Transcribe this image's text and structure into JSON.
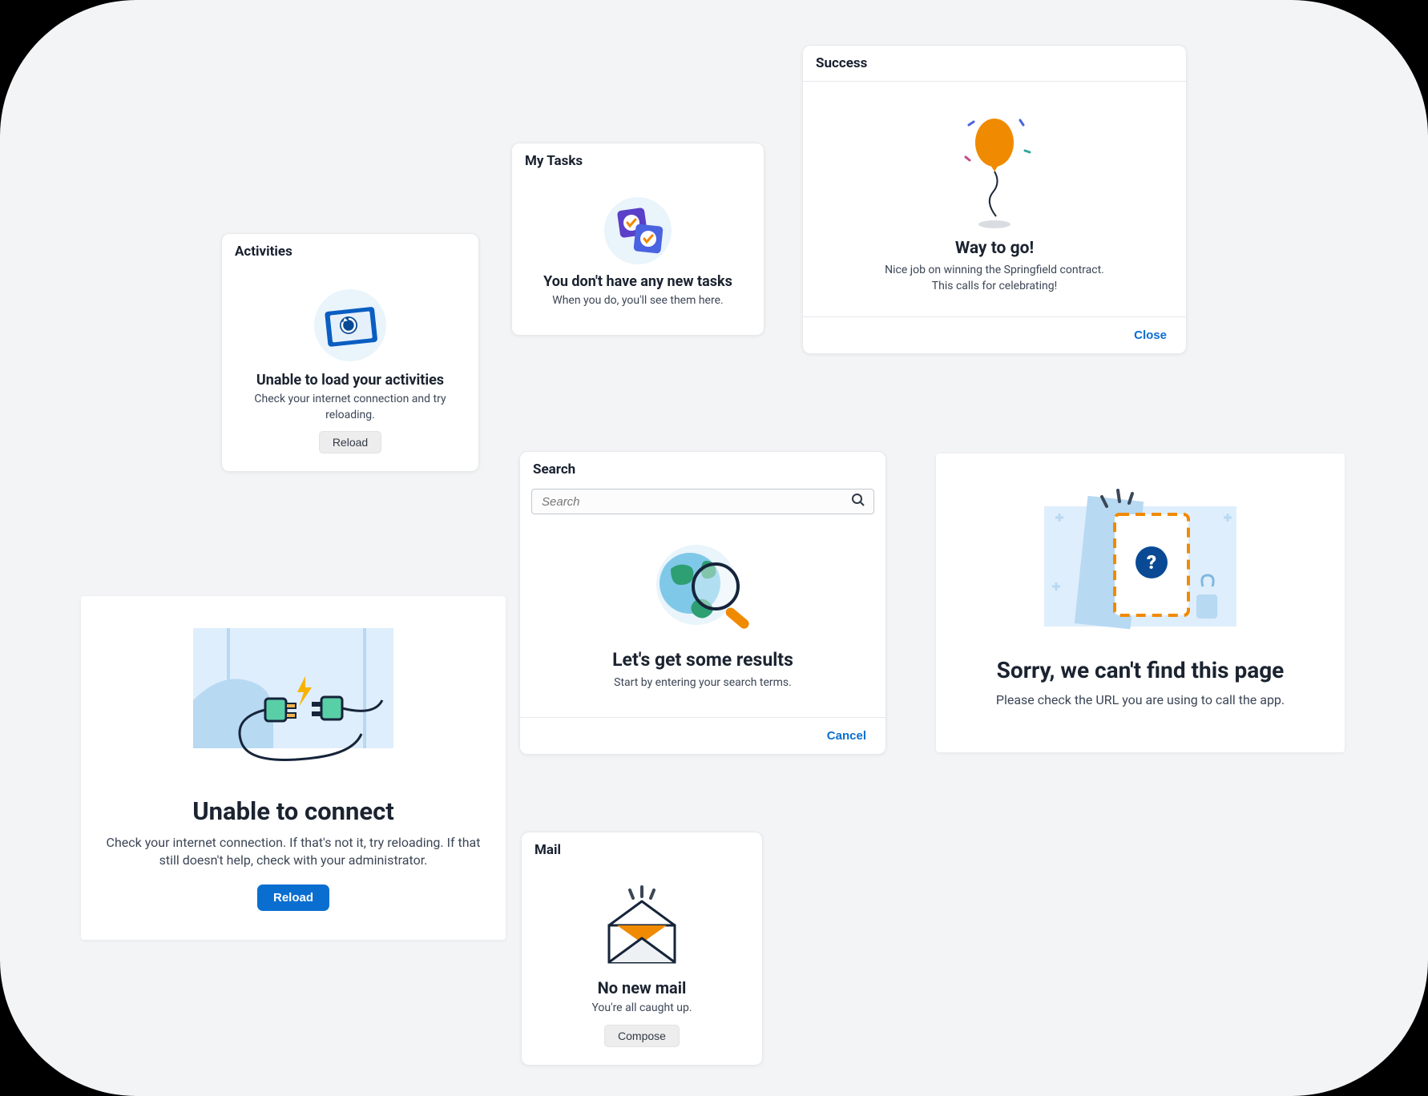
{
  "activities": {
    "header": "Activities",
    "title": "Unable to load your activities",
    "desc": "Check your internet connection and try reloading.",
    "button": "Reload"
  },
  "tasks": {
    "header": "My Tasks",
    "title": "You don't have any new tasks",
    "desc": "When you do, you'll see them here."
  },
  "success": {
    "header": "Success",
    "title": "Way to go!",
    "desc_line1": "Nice job on winning the Springfield contract.",
    "desc_line2": "This calls for celebrating!",
    "close": "Close"
  },
  "connect": {
    "title": "Unable to connect",
    "desc": "Check your internet connection. If that's not it, try reloading. If that still doesn't help, check with your administrator.",
    "button": "Reload"
  },
  "search": {
    "header": "Search",
    "placeholder": "Search",
    "title": "Let's get some results",
    "desc": "Start by entering your search terms.",
    "cancel": "Cancel"
  },
  "notfound": {
    "title": "Sorry, we can't find this page",
    "desc": "Please check the URL you are using to call the app."
  },
  "mail": {
    "header": "Mail",
    "title": "No new mail",
    "desc": "You're all caught up.",
    "button": "Compose"
  }
}
